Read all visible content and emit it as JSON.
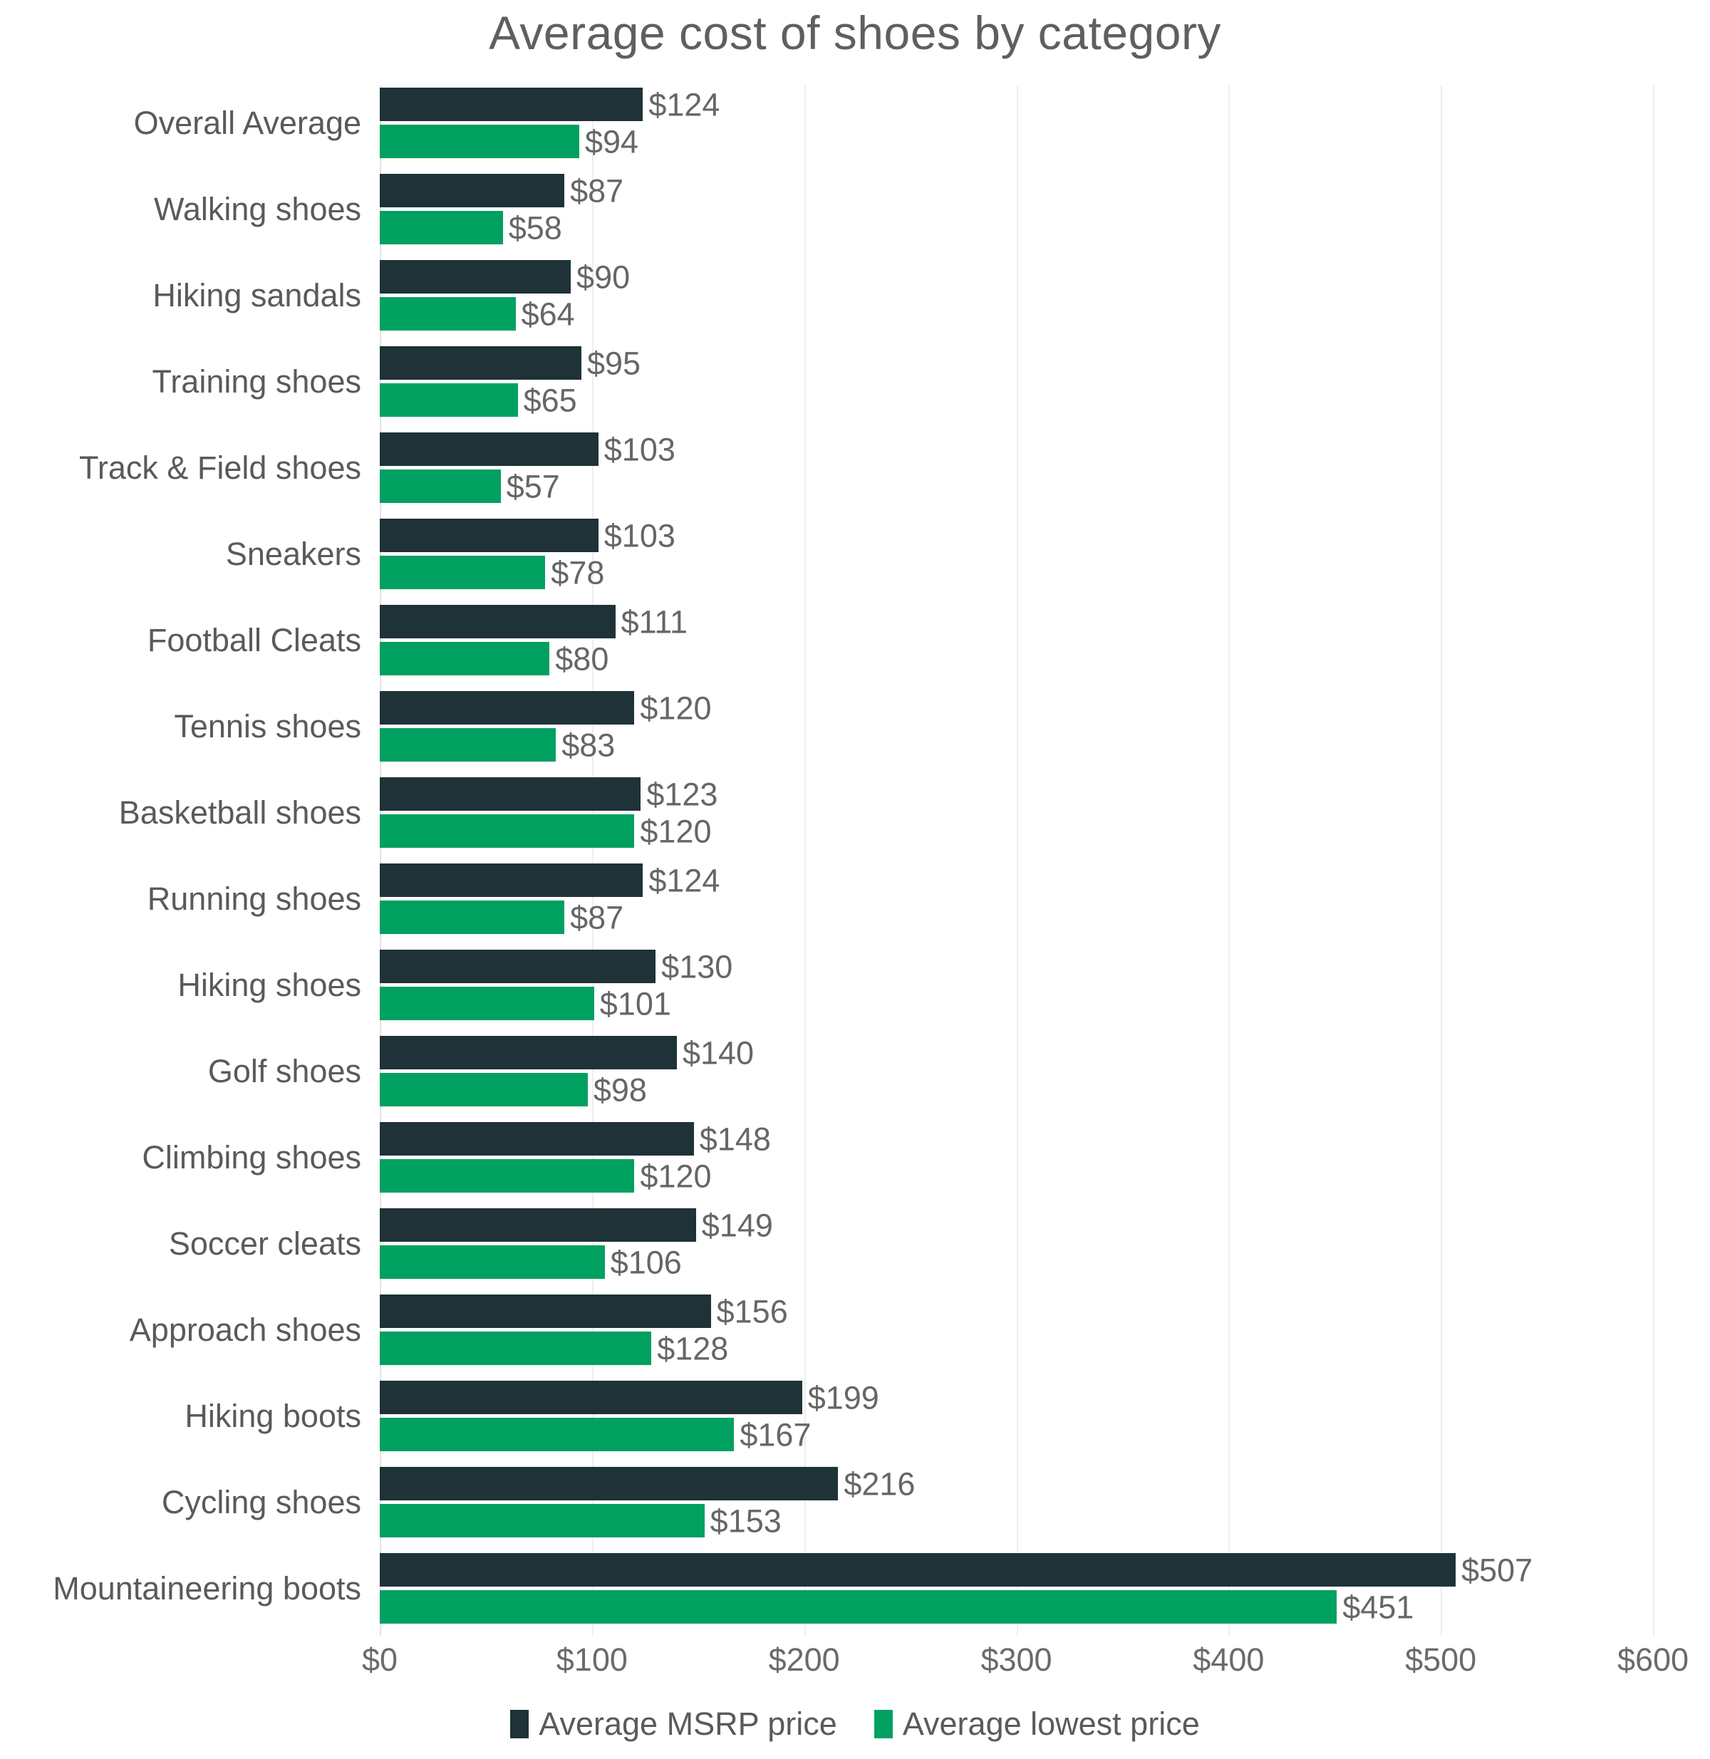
{
  "chart_data": {
    "type": "bar",
    "orientation": "horizontal",
    "grouped": true,
    "title": "Average cost of shoes by category",
    "xlabel": "",
    "ylabel": "",
    "xlim": [
      0,
      600
    ],
    "x_ticks": [
      0,
      100,
      200,
      300,
      400,
      500,
      600
    ],
    "x_tick_labels": [
      "$0",
      "$100",
      "$200",
      "$300",
      "$400",
      "$500",
      "$600"
    ],
    "grid": "vertical",
    "legend_position": "bottom-center",
    "categories": [
      "Overall Average",
      "Walking shoes",
      "Hiking sandals",
      "Training shoes",
      "Track & Field shoes",
      "Sneakers",
      "Football Cleats",
      "Tennis shoes",
      "Basketball shoes",
      "Running shoes",
      "Hiking shoes",
      "Golf shoes",
      "Climbing shoes",
      "Soccer cleats",
      "Approach shoes",
      "Hiking boots",
      "Cycling shoes",
      "Mountaineering boots"
    ],
    "series": [
      {
        "name": "Average MSRP price",
        "color": "#1e3238",
        "values": [
          124,
          87,
          90,
          95,
          103,
          103,
          111,
          120,
          123,
          124,
          130,
          140,
          148,
          149,
          156,
          199,
          216,
          507
        ],
        "value_labels": [
          "$124",
          "$87",
          "$90",
          "$95",
          "$103",
          "$103",
          "$111",
          "$120",
          "$123",
          "$124",
          "$130",
          "$140",
          "$148",
          "$149",
          "$156",
          "$199",
          "$216",
          "$507"
        ]
      },
      {
        "name": "Average lowest price",
        "color": "#00a060",
        "values": [
          94,
          58,
          64,
          65,
          57,
          78,
          80,
          83,
          120,
          87,
          101,
          98,
          120,
          106,
          128,
          167,
          153,
          451
        ],
        "value_labels": [
          "$94",
          "$58",
          "$64",
          "$65",
          "$57",
          "$78",
          "$80",
          "$83",
          "$120",
          "$87",
          "$101",
          "$98",
          "$120",
          "$106",
          "$128",
          "$167",
          "$153",
          "$451"
        ]
      }
    ]
  },
  "legend": {
    "items": [
      {
        "label": "Average MSRP price",
        "color": "#1e3238"
      },
      {
        "label": "Average lowest price",
        "color": "#00a060"
      }
    ]
  }
}
